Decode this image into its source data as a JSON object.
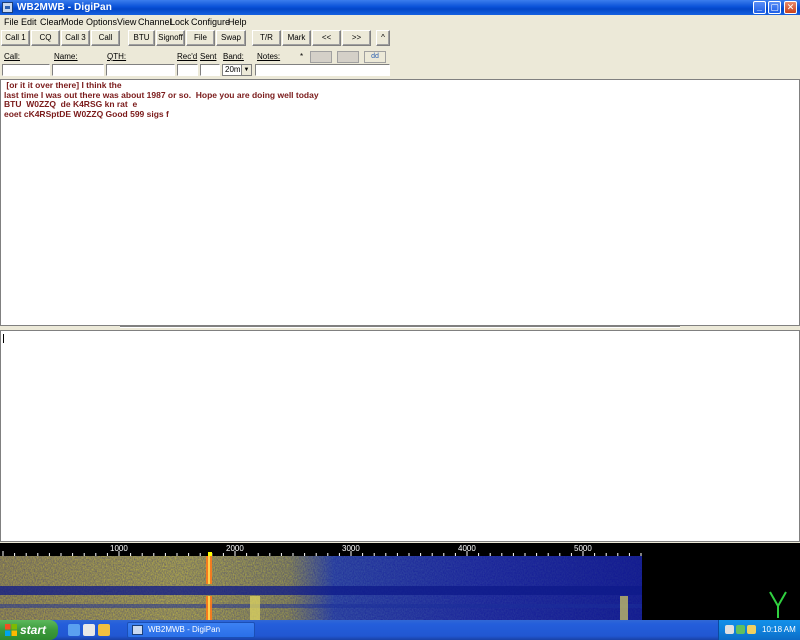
{
  "window": {
    "title": "WB2MWB - DigiPan",
    "controls": {
      "minimize": "_",
      "maximize": "▢",
      "close": "✕"
    }
  },
  "menu": [
    "File",
    "Edit",
    "Clear",
    "Mode",
    "Options",
    "View",
    "Channel",
    "Lock",
    "Configure",
    "Help"
  ],
  "toolbar": {
    "buttons": [
      "Call 1",
      "CQ",
      "Call 3",
      "Call",
      "BTU",
      "Signoff",
      "File",
      "Swap",
      "T/R",
      "Mark",
      "<<",
      ">>",
      "^"
    ]
  },
  "fields": {
    "call_label": "Call:",
    "name_label": "Name:",
    "qth_label": "QTH:",
    "recd_label": "Rec'd",
    "sent_label": "Sent",
    "band_label": "Band:",
    "notes_label": "Notes:",
    "notes_marker": "*",
    "band_value": "20m",
    "band_arrow": "▼",
    "icon_btn_3": "dd"
  },
  "rx": {
    "lines": [
      " [or it it over there] I think the",
      "last time I was out there was about 1987 or so.  Hope you are doing well today",
      "BTU  W0ZZQ  de K4RSG kn rat  e",
      "eoet cK4RSptDE W0ZZQ Good 599 sigs f"
    ]
  },
  "waterfall": {
    "scale_labels": [
      "1000",
      "2000",
      "3000",
      "4000",
      "5000"
    ]
  },
  "taskbar": {
    "start_label": "start",
    "task_item": "WB2MWB - DigiPan",
    "clock": "10:18 AM"
  },
  "colors": {
    "rx_text": "#7a1a1a",
    "titlebar": "#0a52d8",
    "taskbar": "#245edb"
  }
}
